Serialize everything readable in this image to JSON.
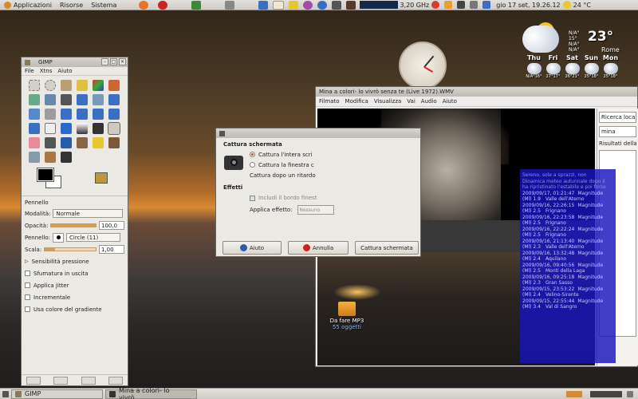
{
  "top_panel": {
    "menus": [
      "Applicazioni",
      "Risorse",
      "Sistema"
    ],
    "cpu": "3,20 GHz",
    "datetime": "gio 17 set, 19.26.12",
    "temperature": "24 °C"
  },
  "weather": {
    "now_temp": "23°",
    "now_details": [
      "N/A°",
      "15°",
      "N/A°",
      "N/A°"
    ],
    "city": "Rome",
    "days": [
      {
        "name": "Thu",
        "hilo": "N/A°16°"
      },
      {
        "name": "Fri",
        "hilo": "27°17°"
      },
      {
        "name": "Sat",
        "hilo": "26°21°"
      },
      {
        "name": "Sun",
        "hilo": "25°18°"
      },
      {
        "name": "Mon",
        "hilo": "25°18°"
      }
    ]
  },
  "gimp": {
    "title": "GIMP",
    "menus": [
      "File",
      "Xtns",
      "Aiuto"
    ],
    "options_title": "Pennello",
    "mode_label": "Modalità:",
    "mode_value": "Normale",
    "opacity_label": "Opacità:",
    "opacity_value": "100,0",
    "brush_label": "Pennello:",
    "brush_value": "Circle (11)",
    "scale_label": "Scala:",
    "scale_value": "1,00",
    "pressure": "Sensibilità pressione",
    "checks": [
      "Sfumatura in uscita",
      "Applica jitter",
      "Incrementale",
      "Usa colore del gradiente"
    ],
    "opacity_fraction": 1.0,
    "scale_fraction": 0.2
  },
  "screenshot_dialog": {
    "section1": "Cattura schermata",
    "radio1": "Cattura l'intera scri",
    "radio2": "Cattura la finestra c",
    "delay": "Cattura dopo un ritardo",
    "section2": "Effetti",
    "include_border": "Includi il bordo finest",
    "apply_effect": "Applica effetto:",
    "effect_value": "Nessuno",
    "btn_help": "Aiuto",
    "btn_cancel": "Annulla",
    "btn_capture": "Cattura schermata"
  },
  "player": {
    "title": "Mina a colori- lo vivrò senza te (Live 1972).WMV",
    "menus": [
      "Filmato",
      "Modifica",
      "Visualizza",
      "Vai",
      "Audio",
      "Aiuto"
    ],
    "side_search_label": "Ricerca locale",
    "side_query": "mina",
    "side_results_label": "Risultati della r"
  },
  "quake_list": {
    "header": [
      "Sereno, sole a sprazzi, non",
      "Dinamica meteo autunnale dopo il",
      "ha ripristinato l'estabile e poi forse"
    ],
    "entries": [
      {
        "when": "2009/09/17, 01:21:47",
        "mag": "Magnitude",
        "value": "(Ml) 1.9",
        "place": "Valle dell'Aterno"
      },
      {
        "when": "2009/09/16, 22:26:15",
        "mag": "Magnitude",
        "value": "(Ml) 2.5",
        "place": "Frignano"
      },
      {
        "when": "2009/09/16, 22:23:58",
        "mag": "Magnitude",
        "value": "(Ml) 2.5",
        "place": "Frignano"
      },
      {
        "when": "2009/09/16, 22:22:24",
        "mag": "Magnitude",
        "value": "(Ml) 2.5",
        "place": "Frignano"
      },
      {
        "when": "2009/09/16, 21:13:40",
        "mag": "Magnitude",
        "value": "(Ml) 2.3",
        "place": "Valle dell'Aterno"
      },
      {
        "when": "2009/09/16, 13:32:48",
        "mag": "Magnitude",
        "value": "(Ml) 2.4",
        "place": "Aquilano"
      },
      {
        "when": "2009/09/16, 09:40:56",
        "mag": "Magnitude",
        "value": "(Ml) 2.5",
        "place": "Monti della Laga"
      },
      {
        "when": "2009/09/16, 09:25:18",
        "mag": "Magnitude",
        "value": "(Ml) 2.3",
        "place": "Gran Sasso"
      },
      {
        "when": "2009/09/15, 23:53:22",
        "mag": "Magnitude",
        "value": "(Ml) 2.4",
        "place": "Velino-Sirente"
      },
      {
        "when": "2009/09/15, 22:55:44",
        "mag": "Magnitude",
        "value": "(Ml) 3.4",
        "place": "Val di Sangro"
      }
    ]
  },
  "desktop": {
    "folder_name": "Da fare MP3",
    "folder_count": "55 oggetti"
  },
  "taskbar": {
    "items": [
      "GIMP",
      "Mina a colori- lo vivrò..."
    ]
  }
}
